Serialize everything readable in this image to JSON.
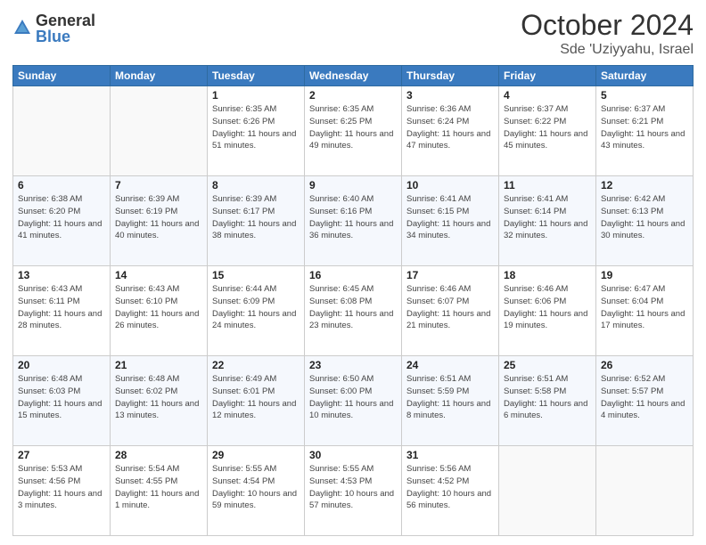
{
  "header": {
    "logo_general": "General",
    "logo_blue": "Blue",
    "month_title": "October 2024",
    "location": "Sde 'Uziyyahu, Israel"
  },
  "weekdays": [
    "Sunday",
    "Monday",
    "Tuesday",
    "Wednesday",
    "Thursday",
    "Friday",
    "Saturday"
  ],
  "weeks": [
    [
      {
        "day": "",
        "info": ""
      },
      {
        "day": "",
        "info": ""
      },
      {
        "day": "1",
        "info": "Sunrise: 6:35 AM\nSunset: 6:26 PM\nDaylight: 11 hours\nand 51 minutes."
      },
      {
        "day": "2",
        "info": "Sunrise: 6:35 AM\nSunset: 6:25 PM\nDaylight: 11 hours\nand 49 minutes."
      },
      {
        "day": "3",
        "info": "Sunrise: 6:36 AM\nSunset: 6:24 PM\nDaylight: 11 hours\nand 47 minutes."
      },
      {
        "day": "4",
        "info": "Sunrise: 6:37 AM\nSunset: 6:22 PM\nDaylight: 11 hours\nand 45 minutes."
      },
      {
        "day": "5",
        "info": "Sunrise: 6:37 AM\nSunset: 6:21 PM\nDaylight: 11 hours\nand 43 minutes."
      }
    ],
    [
      {
        "day": "6",
        "info": "Sunrise: 6:38 AM\nSunset: 6:20 PM\nDaylight: 11 hours\nand 41 minutes."
      },
      {
        "day": "7",
        "info": "Sunrise: 6:39 AM\nSunset: 6:19 PM\nDaylight: 11 hours\nand 40 minutes."
      },
      {
        "day": "8",
        "info": "Sunrise: 6:39 AM\nSunset: 6:17 PM\nDaylight: 11 hours\nand 38 minutes."
      },
      {
        "day": "9",
        "info": "Sunrise: 6:40 AM\nSunset: 6:16 PM\nDaylight: 11 hours\nand 36 minutes."
      },
      {
        "day": "10",
        "info": "Sunrise: 6:41 AM\nSunset: 6:15 PM\nDaylight: 11 hours\nand 34 minutes."
      },
      {
        "day": "11",
        "info": "Sunrise: 6:41 AM\nSunset: 6:14 PM\nDaylight: 11 hours\nand 32 minutes."
      },
      {
        "day": "12",
        "info": "Sunrise: 6:42 AM\nSunset: 6:13 PM\nDaylight: 11 hours\nand 30 minutes."
      }
    ],
    [
      {
        "day": "13",
        "info": "Sunrise: 6:43 AM\nSunset: 6:11 PM\nDaylight: 11 hours\nand 28 minutes."
      },
      {
        "day": "14",
        "info": "Sunrise: 6:43 AM\nSunset: 6:10 PM\nDaylight: 11 hours\nand 26 minutes."
      },
      {
        "day": "15",
        "info": "Sunrise: 6:44 AM\nSunset: 6:09 PM\nDaylight: 11 hours\nand 24 minutes."
      },
      {
        "day": "16",
        "info": "Sunrise: 6:45 AM\nSunset: 6:08 PM\nDaylight: 11 hours\nand 23 minutes."
      },
      {
        "day": "17",
        "info": "Sunrise: 6:46 AM\nSunset: 6:07 PM\nDaylight: 11 hours\nand 21 minutes."
      },
      {
        "day": "18",
        "info": "Sunrise: 6:46 AM\nSunset: 6:06 PM\nDaylight: 11 hours\nand 19 minutes."
      },
      {
        "day": "19",
        "info": "Sunrise: 6:47 AM\nSunset: 6:04 PM\nDaylight: 11 hours\nand 17 minutes."
      }
    ],
    [
      {
        "day": "20",
        "info": "Sunrise: 6:48 AM\nSunset: 6:03 PM\nDaylight: 11 hours\nand 15 minutes."
      },
      {
        "day": "21",
        "info": "Sunrise: 6:48 AM\nSunset: 6:02 PM\nDaylight: 11 hours\nand 13 minutes."
      },
      {
        "day": "22",
        "info": "Sunrise: 6:49 AM\nSunset: 6:01 PM\nDaylight: 11 hours\nand 12 minutes."
      },
      {
        "day": "23",
        "info": "Sunrise: 6:50 AM\nSunset: 6:00 PM\nDaylight: 11 hours\nand 10 minutes."
      },
      {
        "day": "24",
        "info": "Sunrise: 6:51 AM\nSunset: 5:59 PM\nDaylight: 11 hours\nand 8 minutes."
      },
      {
        "day": "25",
        "info": "Sunrise: 6:51 AM\nSunset: 5:58 PM\nDaylight: 11 hours\nand 6 minutes."
      },
      {
        "day": "26",
        "info": "Sunrise: 6:52 AM\nSunset: 5:57 PM\nDaylight: 11 hours\nand 4 minutes."
      }
    ],
    [
      {
        "day": "27",
        "info": "Sunrise: 5:53 AM\nSunset: 4:56 PM\nDaylight: 11 hours\nand 3 minutes."
      },
      {
        "day": "28",
        "info": "Sunrise: 5:54 AM\nSunset: 4:55 PM\nDaylight: 11 hours\nand 1 minute."
      },
      {
        "day": "29",
        "info": "Sunrise: 5:55 AM\nSunset: 4:54 PM\nDaylight: 10 hours\nand 59 minutes."
      },
      {
        "day": "30",
        "info": "Sunrise: 5:55 AM\nSunset: 4:53 PM\nDaylight: 10 hours\nand 57 minutes."
      },
      {
        "day": "31",
        "info": "Sunrise: 5:56 AM\nSunset: 4:52 PM\nDaylight: 10 hours\nand 56 minutes."
      },
      {
        "day": "",
        "info": ""
      },
      {
        "day": "",
        "info": ""
      }
    ]
  ]
}
